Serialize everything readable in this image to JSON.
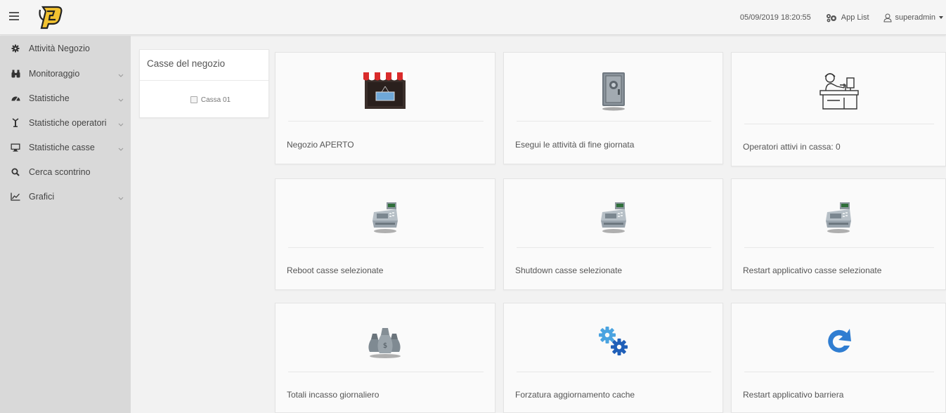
{
  "header": {
    "datetime": "05/09/2019 18:20:55",
    "app_list_label": "App List",
    "user_label": "superadmin"
  },
  "sidebar": {
    "items": [
      {
        "label": "Attività Negozio",
        "icon": "gear-icon",
        "has_submenu": false
      },
      {
        "label": "Monitoraggio",
        "icon": "binoculars-icon",
        "has_submenu": true
      },
      {
        "label": "Statistiche",
        "icon": "tachometer-icon",
        "has_submenu": true
      },
      {
        "label": "Statistiche operatori",
        "icon": "operator-icon",
        "has_submenu": true
      },
      {
        "label": "Statistiche casse",
        "icon": "monitor-icon",
        "has_submenu": true
      },
      {
        "label": "Cerca scontrino",
        "icon": "search-icon",
        "has_submenu": false
      },
      {
        "label": "Grafici",
        "icon": "line-chart-icon",
        "has_submenu": true
      }
    ]
  },
  "casse_panel": {
    "title": "Casse del negozio",
    "items": [
      {
        "label": "Cassa 01",
        "checked": false
      }
    ]
  },
  "cards": [
    {
      "label": "Negozio APERTO",
      "icon": "shop-open-icon"
    },
    {
      "label": "Esegui le attività di fine giornata",
      "icon": "safe-icon"
    },
    {
      "label": "Operatori attivi in cassa: 0",
      "icon": "cashier-operator-icon"
    },
    {
      "label": "Reboot casse selezionate",
      "icon": "cash-register-icon"
    },
    {
      "label": "Shutdown casse selezionate",
      "icon": "cash-register-icon"
    },
    {
      "label": "Restart applicativo casse selezionate",
      "icon": "cash-register-icon"
    },
    {
      "label": "Totali incasso giornaliero",
      "icon": "money-bags-icon"
    },
    {
      "label": "Forzatura aggiornamento cache",
      "icon": "gears-icon"
    },
    {
      "label": "Restart applicativo barriera",
      "icon": "refresh-icon"
    }
  ]
}
